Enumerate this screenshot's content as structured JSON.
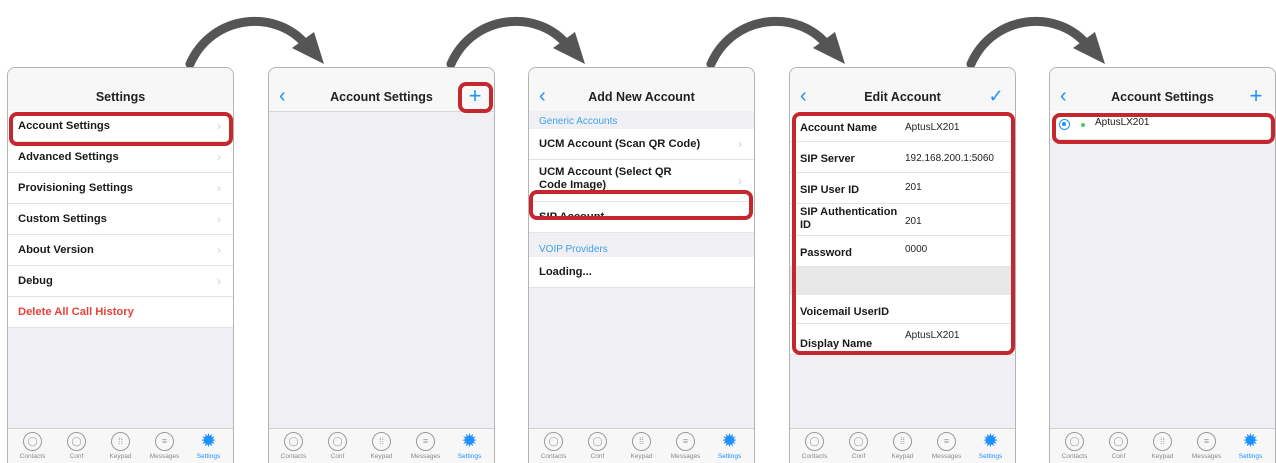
{
  "tabs": [
    {
      "label": "Contacts",
      "icon": "contacts-icon"
    },
    {
      "label": "Conf",
      "icon": "conference-icon"
    },
    {
      "label": "Keypad",
      "icon": "keypad-icon"
    },
    {
      "label": "Messages",
      "icon": "messages-icon"
    },
    {
      "label": "Settings",
      "icon": "settings-gear-icon"
    }
  ],
  "screen1": {
    "title": "Settings",
    "items": [
      {
        "label": "Account Settings"
      },
      {
        "label": "Advanced Settings"
      },
      {
        "label": "Provisioning Settings"
      },
      {
        "label": "Custom Settings"
      },
      {
        "label": "About Version"
      },
      {
        "label": "Debug"
      },
      {
        "label": "Delete All Call History"
      }
    ]
  },
  "screen2": {
    "title": "Account Settings",
    "add": "+"
  },
  "screen3": {
    "title": "Add New Account",
    "generic_header": "Generic Accounts",
    "generic": [
      {
        "label": "UCM Account (Scan QR Code)"
      },
      {
        "label": "UCM Account (Select QR Code Image)"
      },
      {
        "label": "SIP  Account"
      }
    ],
    "voip_header": "VOIP Providers",
    "voip": [
      {
        "label": "Loading..."
      }
    ]
  },
  "screen4": {
    "title": "Edit Account",
    "check": "✓",
    "fields": [
      {
        "label": "Account Name",
        "value": "AptusLX201"
      },
      {
        "label": "SIP Server",
        "value": "192.168.200.1:5060"
      },
      {
        "label": "SIP User ID",
        "value": "201"
      },
      {
        "label": "SIP Authentication ID",
        "value": "201"
      },
      {
        "label": "Password",
        "value": "0000"
      },
      {
        "label": "Voicemail UserID",
        "value": ""
      },
      {
        "label": "Display Name",
        "value": "AptusLX201"
      }
    ]
  },
  "screen5": {
    "title": "Account Settings",
    "add": "+",
    "account": "AptusLX201"
  },
  "colors": {
    "accent": "#1e90ff",
    "highlight": "#c4282e",
    "danger": "#e8423a",
    "section": "#3fa3e8",
    "arrow": "#555555"
  }
}
